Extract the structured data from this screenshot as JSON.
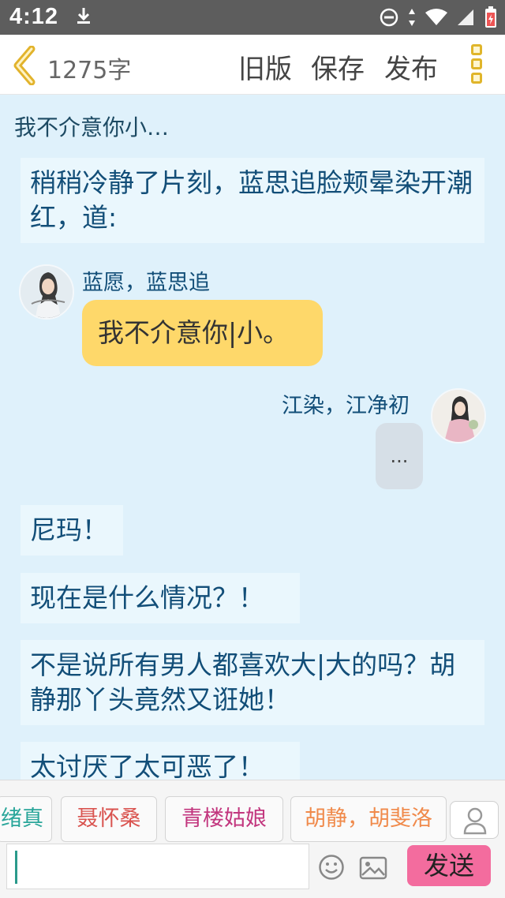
{
  "status_bar": {
    "time": "4:12"
  },
  "header": {
    "word_count": "1275字",
    "old_version": "旧版",
    "save": "保存",
    "publish": "发布"
  },
  "content": {
    "chapter_title": "我不介意你小…",
    "paragraphs": [
      "稍稍冷静了片刻，蓝思追脸颊晕染开潮红，道:",
      "尼玛！",
      "现在是什么情况？！",
      "不是说所有男人都喜欢大|大的吗？胡静那丫头竟然又诳她！",
      "太讨厌了太可恶了！"
    ],
    "dialog_left": {
      "speaker": "蓝愿，蓝思追",
      "text": "我不介意你|小。"
    },
    "dialog_right": {
      "speaker": "江染，江净初",
      "text": "..."
    }
  },
  "bottom": {
    "chips": [
      "绪真",
      "聂怀桑",
      "青楼姑娘",
      "胡静，胡斐洛"
    ],
    "chip_colors": [
      "#2aa69a",
      "#d9534f",
      "#c2367e",
      "#f08a4b"
    ],
    "send": "发送"
  }
}
